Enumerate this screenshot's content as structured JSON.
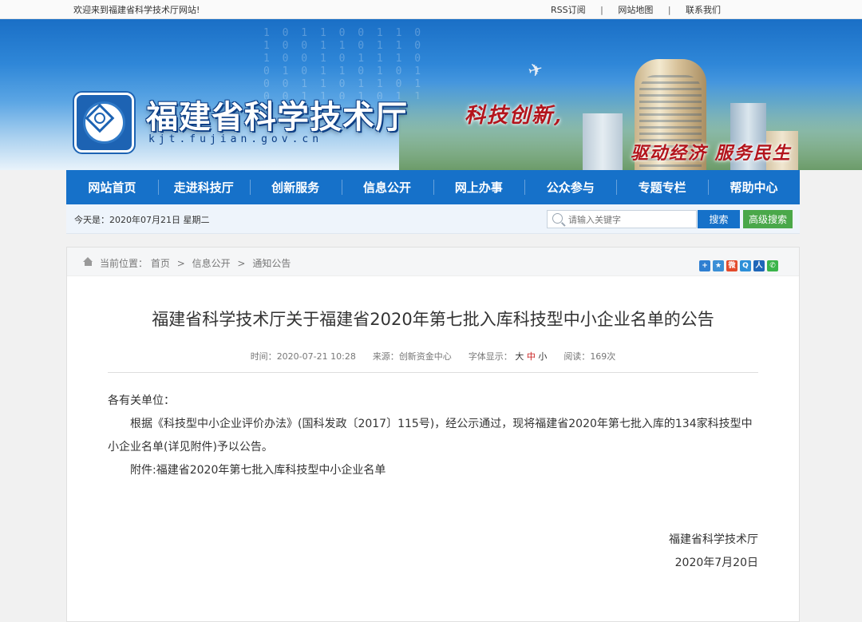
{
  "topbar": {
    "welcome": "欢迎来到福建省科学技术厅网站!",
    "links": [
      "RSS订阅",
      "网站地图",
      "联系我们"
    ],
    "separator": "|"
  },
  "banner": {
    "site_title": "福建省科学技术厅",
    "domain": "kjt.fujian.gov.cn",
    "slogan_top": "科技创新,",
    "slogan_bottom": "驱动经济 服务民生"
  },
  "nav": {
    "items": [
      "网站首页",
      "走进科技厅",
      "创新服务",
      "信息公开",
      "网上办事",
      "公众参与",
      "专题专栏",
      "帮助中心"
    ],
    "color": "#1671c9"
  },
  "datebar": {
    "date_text": "今天是：2020年07月21日  星期二",
    "search_placeholder": "请输入关键字",
    "search_button": "搜索",
    "advanced_button": "高级搜索"
  },
  "breadcrumb": {
    "label": "当前位置：",
    "items": [
      "首页",
      "信息公开",
      "通知公告"
    ],
    "separator": ">"
  },
  "share_icons": [
    "plus-icon",
    "star-icon",
    "weibo-icon",
    "qzone-icon",
    "renren-icon",
    "wechat-icon"
  ],
  "article": {
    "title": "福建省科学技术厅关于福建省2020年第七批入库科技型中小企业名单的公告",
    "meta": {
      "time_label": "时间：",
      "time": "2020-07-21 10:28",
      "source_label": "来源：",
      "source": "创新资金中心",
      "font_label": "字体显示：",
      "font_large": "大",
      "font_medium": "中",
      "font_small": "小",
      "reads_label": "阅读：",
      "reads": "169次"
    },
    "salutation": "各有关单位：",
    "paragraph": "根据《科技型中小企业评价办法》(国科发政〔2017〕115号)，经公示通过，现将福建省2020年第七批入库的134家科技型中小企业名单(详见附件)予以公告。",
    "attachment": "附件:福建省2020年第七批入库科技型中小企业名单",
    "signature_org": "福建省科学技术厅",
    "signature_date": "2020年7月20日"
  }
}
